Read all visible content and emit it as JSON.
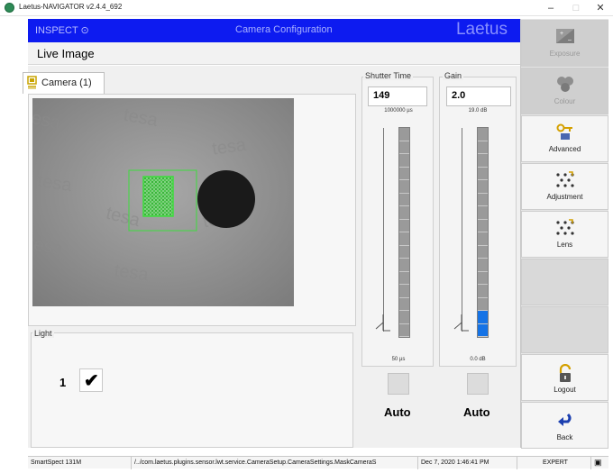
{
  "window": {
    "title": "Laetus-NAVIGATOR v2.4.4_692",
    "minimize": "–",
    "maximize": "□",
    "close": "✕"
  },
  "header": {
    "left": "INSPECT ⊙",
    "center": "Camera Configuration",
    "logo": "Laetus"
  },
  "live_image": {
    "title": "Live Image"
  },
  "camera_tab": {
    "label": "Camera (1)",
    "icon": "camera-icon"
  },
  "image": {
    "watermark": "tesa",
    "watermarks": [
      "tesa",
      "tesa",
      "tesa",
      "tesa",
      "tesa",
      "tesa",
      "tesa",
      "tesa"
    ]
  },
  "light": {
    "label": "Light",
    "index": "1",
    "checked": "✔"
  },
  "shutter": {
    "label": "Shutter Time",
    "value": "149",
    "max_label": "1000000 µs",
    "min_label": "50 µs",
    "auto_label": "Auto",
    "level": 0.0
  },
  "gain": {
    "label": "Gain",
    "value": "2.0",
    "max_label": "19.0 dB",
    "min_label": "0.0 dB",
    "auto_label": "Auto",
    "level": 0.105
  },
  "sidebar": {
    "items": [
      {
        "label": "Exposure",
        "icon": "exposure-icon",
        "enabled": false
      },
      {
        "label": "Colour",
        "icon": "colour-icon",
        "enabled": false
      },
      {
        "label": "Advanced",
        "icon": "keys-icon",
        "enabled": true
      },
      {
        "label": "Adjustment",
        "icon": "dots-icon",
        "enabled": true
      },
      {
        "label": "Lens",
        "icon": "dots-icon",
        "enabled": true
      },
      {
        "label": "Logout",
        "icon": "lock-icon",
        "enabled": true
      },
      {
        "label": "Back",
        "icon": "back-arrow-icon",
        "enabled": true
      }
    ]
  },
  "status": {
    "device": "SmartSpect 131M",
    "path": "/../com.laetus.plugins.sensor.lwt.service.CameraSetup.CameraSettings.MaskCameraS",
    "datetime": "Dec 7, 2020  1:46:41 PM",
    "user": "EXPERT",
    "indicator": "▣"
  },
  "colors": {
    "header_blue": "#0d1bf0",
    "roi_green": "#3ddc3d",
    "gain_fill": "#1573e6"
  }
}
